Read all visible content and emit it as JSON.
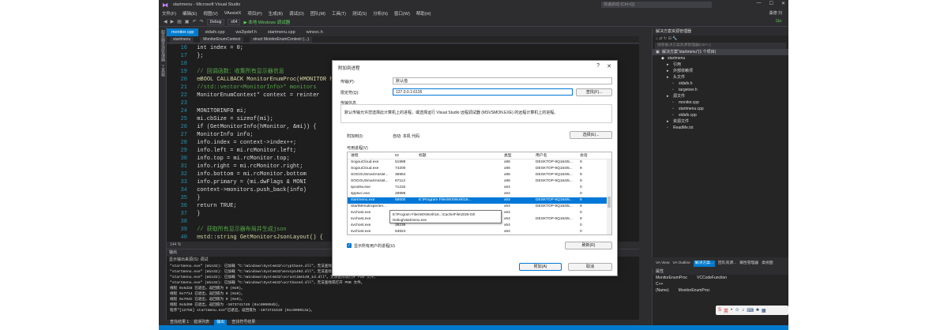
{
  "window": {
    "title": "startmenu - Microsoft Visual Studio",
    "quick_launch": "快速启动 (Ctrl+Q)",
    "user": "桑德 刘",
    "controls": [
      "—",
      "☐",
      "✕"
    ]
  },
  "menu": [
    "文件(F)",
    "编辑(E)",
    "视图(V)",
    "VAssistX",
    "项目(P)",
    "生成(B)",
    "调试(D)",
    "团队(M)",
    "工具(T)",
    "测试(S)",
    "分析(N)",
    "窗口(W)",
    "帮助(H)"
  ],
  "toolbar": {
    "config": "Debug",
    "platform": "x64",
    "run_label": "▶ 本地 Windows 调试器",
    "go_label": "Go"
  },
  "side_strip": [
    "服务器资源管理器",
    "工具箱"
  ],
  "tabs": [
    "monitor.cpp",
    "stdafx.cpp",
    "ws2ipdef.h",
    "startmenu.cpp",
    "winsvc.h"
  ],
  "nav": {
    "project": "startmenu",
    "scope": "MonitorEnumContext",
    "member": "struct MonitorEnumContext::(...)"
  },
  "code": [
    {
      "ln": "16",
      "text": "        int index = 0;"
    },
    {
      "ln": "17",
      "text": "    };"
    },
    {
      "ln": "18",
      "text": ""
    },
    {
      "ln": "19",
      "text": "    // 回调函数：收集所有显示器信息"
    },
    {
      "ln": "20",
      "text": "  ⊟BOOL CALLBACK MonitorEnumProc(HMONITOR hM"
    },
    {
      "ln": "21",
      "text": "        //std::vector<MonitorInfo>* monitors"
    },
    {
      "ln": "22",
      "text": "        MonitorEnumContext* context = reinter"
    },
    {
      "ln": "23",
      "text": ""
    },
    {
      "ln": "24",
      "text": "        MONITORINFO mi;"
    },
    {
      "ln": "25",
      "text": "        mi.cbSize = sizeof(mi);"
    },
    {
      "ln": "26",
      "text": "        if (GetMonitorInfo(hMonitor, &mi)) {"
    },
    {
      "ln": "27",
      "text": "            MonitorInfo info;"
    },
    {
      "ln": "28",
      "text": "            info.index = context->index++;"
    },
    {
      "ln": "29",
      "text": "            info.left = mi.rcMonitor.left;"
    },
    {
      "ln": "30",
      "text": "            info.top = mi.rcMonitor.top;"
    },
    {
      "ln": "31",
      "text": "            info.right = mi.rcMonitor.right;"
    },
    {
      "ln": "32",
      "text": "            info.bottom = mi.rcMonitor.bottom"
    },
    {
      "ln": "33",
      "text": "            info.primary = (mi.dwFlags & MONI"
    },
    {
      "ln": "34",
      "text": "            context->monitors.push_back(info)"
    },
    {
      "ln": "35",
      "text": "        }"
    },
    {
      "ln": "36",
      "text": "        return TRUE;"
    },
    {
      "ln": "37",
      "text": "    }"
    },
    {
      "ln": "38",
      "text": ""
    },
    {
      "ln": "39",
      "text": "    // 获取所有显示器布局并生成json"
    },
    {
      "ln": "40",
      "text": "  ⊟std::string GetMonitorsJsonLayout() {"
    }
  ],
  "editor_status": "144 %",
  "output": {
    "title": "输出",
    "source_label": "显示输出来源(S): 调试",
    "lines": [
      "\"startmenu.exe\" (Win32): 已加载 \"C:\\Windows\\System32\\cryptbase.dll\"。无法查找或打开",
      "\"startmenu.exe\" (Win32): 已加载 \"C:\\Windows\\System32\\msvcp140d.dll\"。无法查找或打开",
      "\"startmenu.exe\" (Win32): 已加载 \"C:\\Windows\\System32\\vcruntime140_1d.dll\"。无法查找或打开 PDB 文件。",
      "\"startmenu.exe\" (Win32): 已加载 \"C:\\Windows\\System32\\ucrtbased.dll\"。无法查找或打开 PDB 文件。",
      "线程 0x5d28 已退出，返回值为 0 (0x0)。",
      "线程 0x7714 已退出，返回值为 0 (0x0)。",
      "线程 0x704C 已退出，返回值为 0 (0x0)。",
      "线程 0x5d00 已退出，返回值为 -1073741749 (0xc000004b)。",
      "程序\"[12756] startmenu.exe\"已退出，返回值为 -1073741510 (0xc000013a)。"
    ]
  },
  "bottom_tabs": [
    "查找结果 1",
    "错误列表",
    "输出",
    "查找符号结果"
  ],
  "solution": {
    "title": "解决方案资源管理器",
    "search_placeholder": "搜索解决方案资源管理器(Ctrl+;)",
    "items": [
      {
        "depth": 0,
        "label": "解决方案\"startmenu\"(1 个项目)",
        "icon": "solution-icon"
      },
      {
        "depth": 1,
        "label": "startmenu",
        "icon": "project-icon"
      },
      {
        "depth": 2,
        "label": "引用",
        "icon": "folder-icon"
      },
      {
        "depth": 2,
        "label": "外部依赖项",
        "icon": "folder-icon"
      },
      {
        "depth": 2,
        "label": "头文件",
        "icon": "folder-icon"
      },
      {
        "depth": 3,
        "label": "stdafx.h",
        "icon": "file-icon"
      },
      {
        "depth": 3,
        "label": "targetver.h",
        "icon": "file-icon"
      },
      {
        "depth": 2,
        "label": "源文件",
        "icon": "folder-icon"
      },
      {
        "depth": 3,
        "label": "monitor.cpp",
        "icon": "file-icon"
      },
      {
        "depth": 3,
        "label": "startmenu.cpp",
        "icon": "file-icon"
      },
      {
        "depth": 3,
        "label": "stdafx.cpp",
        "icon": "file-icon"
      },
      {
        "depth": 2,
        "label": "资源文件",
        "icon": "folder-icon"
      },
      {
        "depth": 2,
        "label": "ReadMe.txt",
        "icon": "file-icon"
      }
    ],
    "tabs": [
      "VA View",
      "VA Outline",
      "解决方案...",
      "团队资源...",
      "属性管理器",
      "类视图"
    ]
  },
  "properties": {
    "title": "属性",
    "object": "MonitorEnumProc",
    "object_type": "VCCodeFunction",
    "rows": [
      [
        "C++",
        ""
      ],
      [
        "(Name)",
        "MonitorEnumProc"
      ]
    ]
  },
  "dialog": {
    "title": "附加到进程",
    "transport_label": "传输(P):",
    "transport_value": "默认值",
    "qualifier_label": "限定符(Q):",
    "qualifier_value": "127.0.0.1:6135",
    "find_button": "查找(F)...",
    "transport_info_label": "传输信息",
    "transport_info_text": "默认传输允许您选择此计算机上的进程，或选择运行 Visual Studio 远程调试器 (MSVSMON.EXE) 的远程计算机上的进程。",
    "attach_to_label": "附加到(I):",
    "attach_to_value": "自动: 本机 代码",
    "select_button": "选择(E)...",
    "available_label": "可用进程(V)",
    "columns": [
      "进程",
      "ID",
      "标题",
      "类型",
      "用户名",
      "会话"
    ],
    "processes": [
      [
        "SogouCloud.exe",
        "51988",
        "",
        "x86",
        "DESKTOP-9Q164I5...",
        "9"
      ],
      [
        "SogouCloud.exe",
        "74200",
        "",
        "x86",
        "DESKTOP-9Q164I5...",
        "9"
      ],
      [
        "SOGOUSmartAssist...",
        "36964",
        "",
        "x86",
        "DESKTOP-9Q164I5...",
        "9"
      ],
      [
        "SOGOUSmartAssist...",
        "67112",
        "",
        "x86",
        "DESKTOP-9Q164I5...",
        "9"
      ],
      [
        "spoolsv.exe",
        "71232",
        "",
        "x64",
        "",
        "0"
      ],
      [
        "sppsvc.exe",
        "28996",
        "",
        "x64",
        "",
        "0"
      ],
      [
        "startmenu.exe",
        "68600",
        "E:\\Program Files\\WXWork\\16...",
        "x64",
        "DESKTOP-9Q164I5...",
        "9"
      ],
      [
        "StartMenuExperien...",
        "",
        "",
        "x64",
        "DESKTOP-9Q164I5...",
        "9"
      ],
      [
        "svchost.exe",
        "",
        "",
        "x64",
        "",
        "0"
      ],
      [
        "svchost.exe",
        "",
        "",
        "x64",
        "DESKTOP-9Q164I5...",
        "9"
      ],
      [
        "svchost.exe",
        "38236",
        "",
        "x64",
        "",
        "0"
      ],
      [
        "svchost.exe",
        "53824",
        "",
        "x64",
        "",
        "0"
      ]
    ],
    "selected_row": 6,
    "tooltip": [
      "E:\\Program Files\\WXWork\\16...\\Cache\\File\\2026-03\\",
      "Debug\\startmenu.exe"
    ],
    "show_all_label": "显示所有用户的进程(U)",
    "refresh_button": "刷新(R)",
    "attach_button": "附加(A)",
    "cancel_button": "取消"
  },
  "colors": {
    "accent": "#007acc",
    "selection": "#0078d7",
    "editor_bg": "#1e1e1e",
    "chrome_bg": "#2d2d30"
  }
}
